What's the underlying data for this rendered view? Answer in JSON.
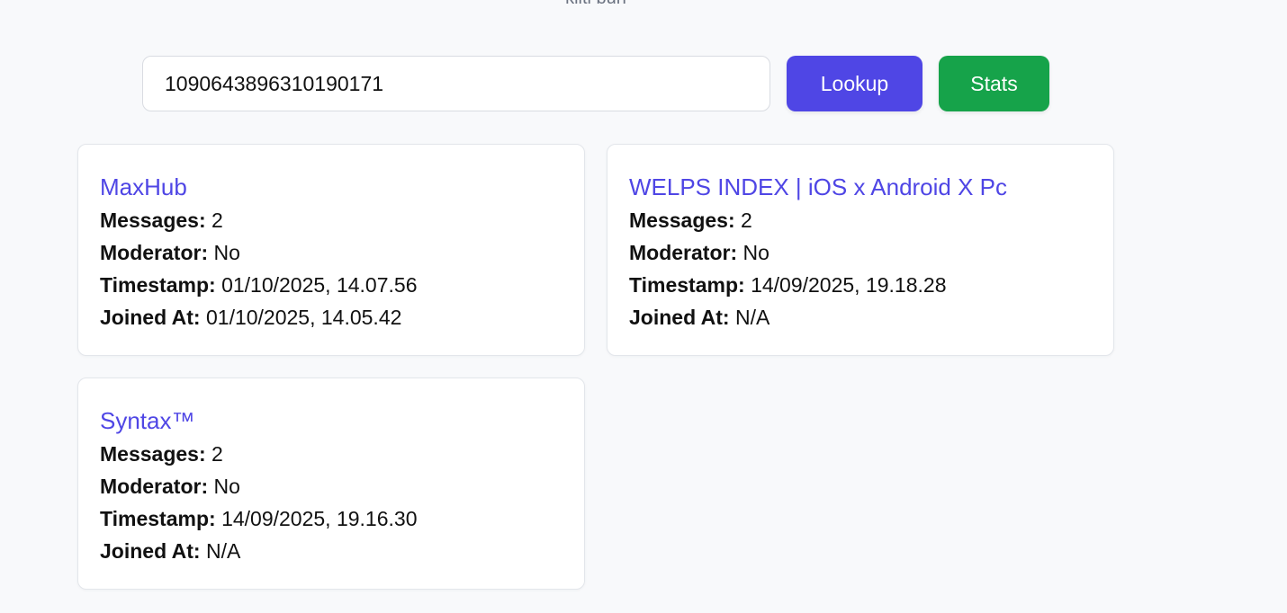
{
  "header": {
    "subtitle": "kiiti buh"
  },
  "search": {
    "value": "1090643896310190171",
    "lookup_label": "Lookup",
    "stats_label": "Stats"
  },
  "colors": {
    "accent": "#4f46e5",
    "stats_button": "#16a34a",
    "background": "#f8f9fb",
    "card_background": "#ffffff"
  },
  "field_labels": {
    "messages": "Messages:",
    "moderator": "Moderator:",
    "timestamp": "Timestamp:",
    "joined_at": "Joined At:"
  },
  "servers": [
    {
      "name": "MaxHub",
      "messages": "2",
      "moderator": "No",
      "timestamp": "01/10/2025, 14.07.56",
      "joined_at": "01/10/2025, 14.05.42"
    },
    {
      "name": "WELPS INDEX | iOS x Android X Pc",
      "messages": "2",
      "moderator": "No",
      "timestamp": "14/09/2025, 19.18.28",
      "joined_at": "N/A"
    },
    {
      "name": "Syntax™",
      "messages": "2",
      "moderator": "No",
      "timestamp": "14/09/2025, 19.16.30",
      "joined_at": "N/A"
    }
  ]
}
